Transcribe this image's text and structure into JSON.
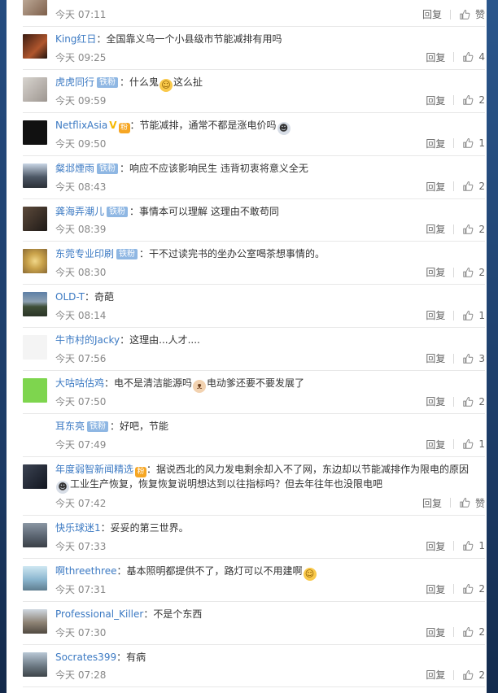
{
  "comments": [
    {
      "avatar": "g0",
      "user": "",
      "text": "",
      "time": "今天 07:11",
      "likes": "赞",
      "tall": false,
      "cut": true
    },
    {
      "avatar": "g1",
      "user": "King红日",
      "badge": "",
      "text": "：全国靠义乌一个小县级市节能减排有用吗",
      "time": "今天 09:25",
      "likes": "4"
    },
    {
      "avatar": "g2",
      "user": "虎虎同行",
      "badge": "铁粉",
      "text": "：什么鬼",
      "emoji": "smile",
      "text2": "这么扯",
      "time": "今天 09:59",
      "likes": "2"
    },
    {
      "avatar": "g3",
      "user": "NetflixAsia",
      "vmark": "V",
      "hot": "粉",
      "text": "：节能减排，通常不都是涨电价吗",
      "emoji": "ghost",
      "time": "今天 09:50",
      "likes": "1"
    },
    {
      "avatar": "g4",
      "user": "粲邶煙雨",
      "badge": "铁粉",
      "text": "：响应不应该影响民生  违背初衷将意义全无",
      "time": "今天 08:43",
      "likes": "2"
    },
    {
      "avatar": "g5",
      "user": "龚海弄潮儿",
      "badge": "铁粉",
      "text": "：事情本可以理解 这理由不敢苟同",
      "time": "今天 08:39",
      "likes": "2"
    },
    {
      "avatar": "g6",
      "user": "东莞专业印刷",
      "badge": "铁粉",
      "text": "：干不过读完书的坐办公室喝茶想事情的。",
      "time": "今天 08:30",
      "likes": "2"
    },
    {
      "avatar": "g7",
      "user": "OLD-T",
      "badge": "",
      "text": "：奇葩",
      "time": "今天 08:14",
      "likes": "1"
    },
    {
      "avatar": "g8",
      "user": "牛市村的Jacky",
      "badge": "",
      "text": "：这理由...人才....",
      "time": "今天 07:56",
      "likes": "3"
    },
    {
      "avatar": "g9",
      "user": "大咕咕估鸡",
      "badge": "",
      "text": "：电不是清洁能源吗",
      "emoji": "cat",
      "text2": "电动爹还要不要发展了",
      "time": "今天 07:50",
      "likes": "2"
    },
    {
      "avatar": "g10",
      "user": "耳东亮",
      "badge": "铁粉",
      "text": "：好吧，节能",
      "time": "今天 07:49",
      "likes": "1"
    },
    {
      "avatar": "g11",
      "user": "年度弱智新闻精选",
      "hot": "粉",
      "text": "：据说西北的风力发电剩余却入不了网，东边却以节能减排作为限电的原因",
      "emoji2": "ghost",
      "text3": "工业生产恢复，恢复恢复说明想达到以往指标吗？但去年往年也没限电吧",
      "time": "今天 07:42",
      "likes": "赞",
      "tall": true
    },
    {
      "avatar": "g12",
      "user": "快乐球迷1",
      "badge": "",
      "text": "：妥妥的第三世界。",
      "time": "今天 07:33",
      "likes": "1"
    },
    {
      "avatar": "g13",
      "user": "啊threethree",
      "badge": "",
      "text": "：基本照明都提供不了，路灯可以不用建啊",
      "emoji": "smile",
      "time": "今天 07:31",
      "likes": "2"
    },
    {
      "avatar": "g14",
      "user": "Professional_Killer",
      "badge": "",
      "text": "：不是个东西",
      "time": "今天 07:30",
      "likes": "2"
    },
    {
      "avatar": "g15",
      "user": "Socrates399",
      "badge": "",
      "text": "：有病",
      "time": "今天 07:28",
      "likes": "2"
    }
  ],
  "labels": {
    "reply": "回复"
  },
  "emoji_glyphs": {
    "smile": "☺",
    "ghost": "☻",
    "cat": "ᴥ"
  }
}
